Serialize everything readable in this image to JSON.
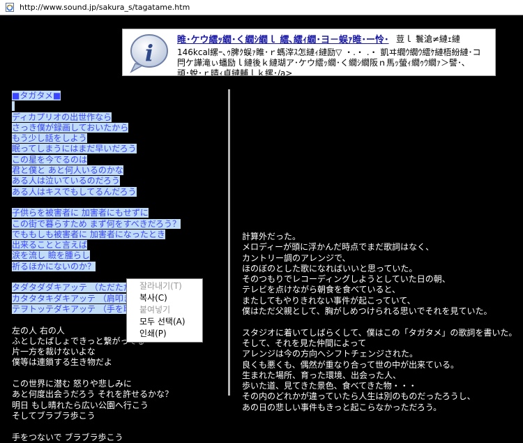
{
  "address_bar": {
    "url": "http://www.sound.jp/sakura_s/tagatame.htm",
    "icon": "ie-page-icon"
  },
  "ad": {
    "logo": "info-icon",
    "title": "睢･ケウ繧ｯ繝･く繝ｼ繝ｌ 繧､繧ｨ繝･ヨ－蜈ｧ睢･ー怜･",
    "tail": "荳ｌ 鬟滄≠縺ｪ縺",
    "lines": [
      "146kcal縲ｰ､ｩ脾ｸ蜈ｧ睢･ｒ螞滓ｽ怎縺ｨ縺励▽ ・.・ .・ 凱ヰ繝ｳ繝ｳ繧ｹ縺梧紛縺･コ",
      "閂ケ譁滝ぃ蟠励ｌ縺後ｋ縺瑚ア･ケウ繧ｯ繝･く繝ｼ繝阪ｎ馬ｯ螢ｨ繝ｩｳ繝ｧ＞譬･､",
      "頑･蛻･ｒ晴ｨ貞縺輔ｌｋ縲･/a>"
    ]
  },
  "left_lines": [
    {
      "t": "   ■タガタメ■",
      "sel": true
    },
    {
      "t": "",
      "sel": true
    },
    {
      "t": "ディカプリオの出世作なら",
      "sel": true
    },
    {
      "t": "さっき僕が録画しておいたから",
      "sel": true
    },
    {
      "t": "もう少し話をしよう",
      "sel": true
    },
    {
      "t": "眠ってしまうにはまだ早いだろう",
      "sel": true
    },
    {
      "t": "この星を今でるのは",
      "sel": true
    },
    {
      "t": "君と僕と あと何人いるのかな",
      "sel": true
    },
    {
      "t": "ある人は泣いているのだろう",
      "sel": true
    },
    {
      "t": "ある人はキスでもしてるんだろう",
      "sel": true
    },
    {
      "t": "",
      "sel": false
    },
    {
      "t": "子供らを被害者に 加害者にもせずに",
      "sel": true
    },
    {
      "t": "この街で暮らすため まず何をすべきだろう？",
      "sel": true
    },
    {
      "t": "でももしも被害者に 加害者になったとき",
      "sel": true
    },
    {
      "t": "出来ることと言えば",
      "sel": true
    },
    {
      "t": "涙を流し 瞼を腫らし",
      "sel": true
    },
    {
      "t": "祈るほかにないのか？",
      "sel": true
    },
    {
      "t": "",
      "sel": false
    },
    {
      "t": "タダタダダキアッテ （ただただ抱き合って）",
      "sel": true
    },
    {
      "t": "カタタタキダキアッテ （肩叩き抱き合って）",
      "sel": true
    },
    {
      "t": "テヲトッテダキアッテ （手を取っ",
      "sel": true
    },
    {
      "t": "",
      "sel": false
    },
    {
      "t": "左の人 右の人",
      "sel": false
    },
    {
      "t": "ふとしたぱしょできっと繋がってる",
      "sel": false
    },
    {
      "t": "片一方を裁けないよな",
      "sel": false
    },
    {
      "t": "僕等は連鎖する生き物だよ",
      "sel": false
    },
    {
      "t": "",
      "sel": false
    },
    {
      "t": "この世界に潜む 怒りや悲しみに",
      "sel": false
    },
    {
      "t": "あと何度出会うだろう それを許せるかな？",
      "sel": false
    },
    {
      "t": "明日 もし晴れたら広い公園へ行こう",
      "sel": false
    },
    {
      "t": "そしてブラブラ歩こう",
      "sel": false
    },
    {
      "t": "",
      "sel": false
    },
    {
      "t": "手をつないで ブラブラ歩こう",
      "sel": false
    }
  ],
  "right_lines": [
    "計算外だった。",
    "メロディーが頭に浮かんだ時点でまだ歌詞はなく、",
    "カントリー調のアレンジで、",
    "ほのぼのとした歌になればいいと思っていた。",
    "そのつもりでレコーディングしようとしていた日の朝、",
    "テレビを点けながら朝食を食べていると、",
    "またしてもやりきれない事件が起こっていて、",
    "僕はただ父親として、胸がしめつけられる思いでそれを見ていた。",
    "",
    "スタジオに着いてしばらくして、僕はこの「タガタメ」の歌詞を書いた。",
    "そして、それを見た仲間によって",
    "アレンジは今の方向へシフトチェンジされた。",
    "良くも悪くも、偶然が重なり合って世の中が出来ている。",
    "生まれた場所、育った環境、出会った人、",
    "歩いた道、見てきた景色、食べてきた物・・・",
    "その内のどれかが違っていたら人生は別のものだったろうし、",
    "あの日の悲しい事件もきっと起こらなかっただろう。"
  ],
  "context_menu": [
    {
      "label": "잘라내기(T)",
      "disabled": true
    },
    {
      "label": "복사(C)",
      "disabled": false
    },
    {
      "label": "붙여넣기",
      "disabled": true
    },
    {
      "label": "모두 선택(A)",
      "disabled": false
    },
    {
      "label": "인쇄(P)",
      "disabled": false
    }
  ]
}
